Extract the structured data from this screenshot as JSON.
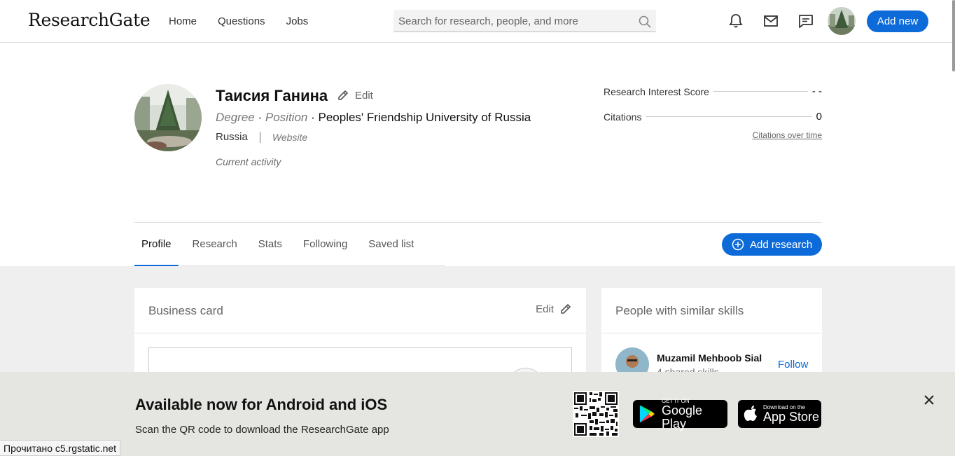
{
  "header": {
    "logo": "ResearchGate",
    "nav": [
      "Home",
      "Questions",
      "Jobs"
    ],
    "search_placeholder": "Search for research, people, and more",
    "add_new": "Add new"
  },
  "profile": {
    "name": "Таисия Ганина",
    "edit_label": "Edit",
    "degree": "Degree",
    "position": "Position",
    "institution": "Peoples' Friendship University of Russia",
    "country": "Russia",
    "website": "Website",
    "current_activity": "Current activity"
  },
  "stats": {
    "ris_label": "Research Interest Score",
    "ris_value": "- -",
    "citations_label": "Citations",
    "citations_value": "0",
    "citations_link": "Citations over time"
  },
  "tabs": [
    "Profile",
    "Research",
    "Stats",
    "Following",
    "Saved list"
  ],
  "add_research": "Add research",
  "business_card": {
    "title": "Business card",
    "edit": "Edit"
  },
  "people": {
    "title": "People with similar skills",
    "person_name": "Muzamil Mehboob Sial",
    "person_skills": "4 shared skills",
    "follow": "Follow"
  },
  "app_banner": {
    "title": "Available now for Android and iOS",
    "subtitle": "Scan the QR code to download the ResearchGate app",
    "google_small": "GET IT ON",
    "google_big": "Google Play",
    "apple_small": "Download on the",
    "apple_big": "App Store"
  },
  "status_bar": "Прочитано c5.rgstatic.net",
  "colors": {
    "accent": "#0c6ad9",
    "banner_bg": "#e5e5e1",
    "page_bg": "#efefef"
  }
}
